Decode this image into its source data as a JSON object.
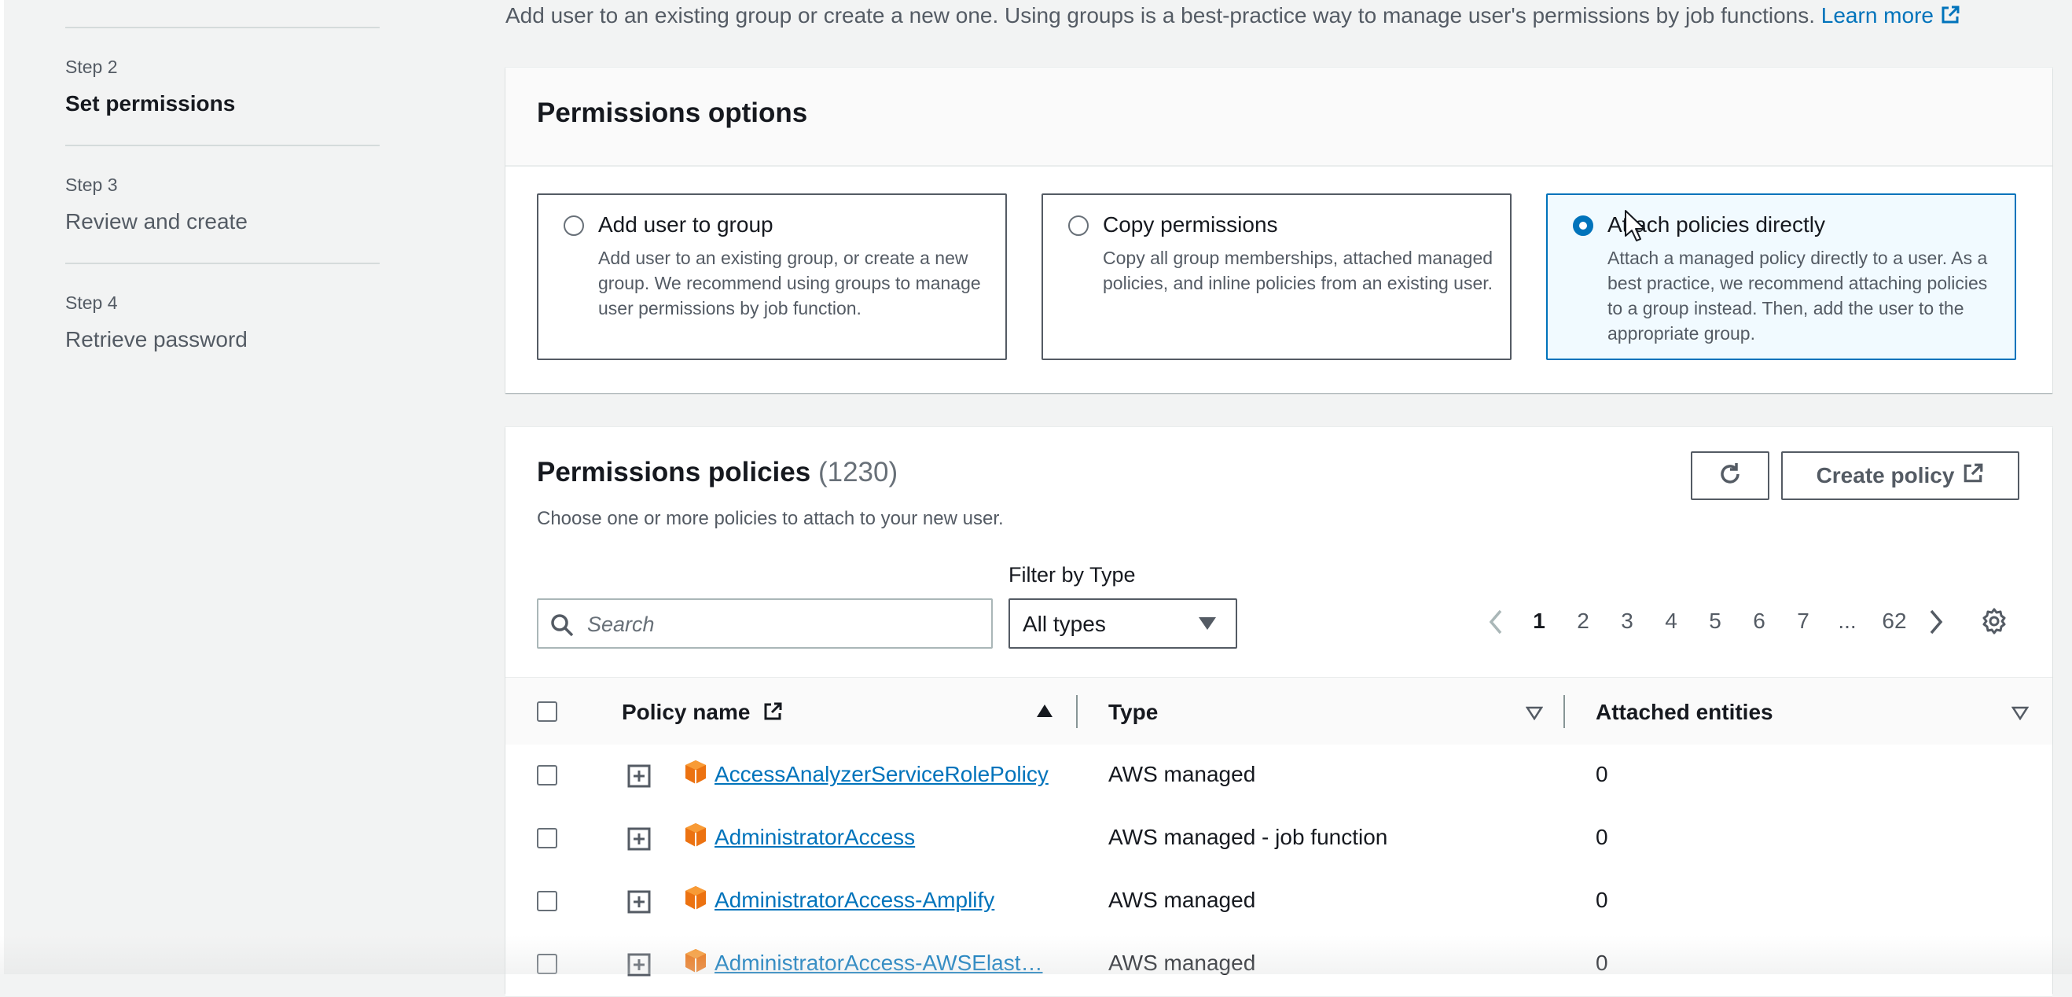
{
  "steps": [
    {
      "num": "Step 2",
      "title": "Set permissions"
    },
    {
      "num": "Step 3",
      "title": "Review and create"
    },
    {
      "num": "Step 4",
      "title": "Retrieve password"
    }
  ],
  "intro": {
    "text": "Add user to an existing group or create a new one. Using groups is a best-practice way to manage user's permissions by job functions.",
    "learn_more": "Learn more"
  },
  "permissions_options": {
    "title": "Permissions options",
    "options": [
      {
        "title": "Add user to group",
        "desc": "Add user to an existing group, or create a new group. We recommend using groups to manage user permissions by job function.",
        "selected": false
      },
      {
        "title": "Copy permissions",
        "desc": "Copy all group memberships, attached managed policies, and inline policies from an existing user.",
        "selected": false
      },
      {
        "title": "Attach policies directly",
        "desc": "Attach a managed policy directly to a user. As a best practice, we recommend attaching policies to a group instead. Then, add the user to the appropriate group.",
        "selected": true
      }
    ]
  },
  "policies": {
    "title": "Permissions policies",
    "count": "(1230)",
    "description": "Choose one or more policies to attach to your new user.",
    "create_label": "Create policy",
    "filter_label": "Filter by Type",
    "search_placeholder": "Search",
    "type_value": "All types",
    "pages": [
      "1",
      "2",
      "3",
      "4",
      "5",
      "6",
      "7",
      "...",
      "62"
    ],
    "current_page": "1",
    "columns": {
      "name": "Policy name",
      "type": "Type",
      "entities": "Attached entities"
    },
    "rows": [
      {
        "name": "AccessAnalyzerServiceRolePolicy",
        "type": "AWS managed",
        "entities": "0"
      },
      {
        "name": "AdministratorAccess",
        "type": "AWS managed - job function",
        "entities": "0"
      },
      {
        "name": "AdministratorAccess-Amplify",
        "type": "AWS managed",
        "entities": "0"
      },
      {
        "name": "AdministratorAccess-AWSElast…",
        "type": "AWS managed",
        "entities": "0"
      }
    ]
  },
  "colors": {
    "accent": "#0073bb",
    "package": "#ec7211",
    "text": "#16191f",
    "muted": "#545b64"
  }
}
